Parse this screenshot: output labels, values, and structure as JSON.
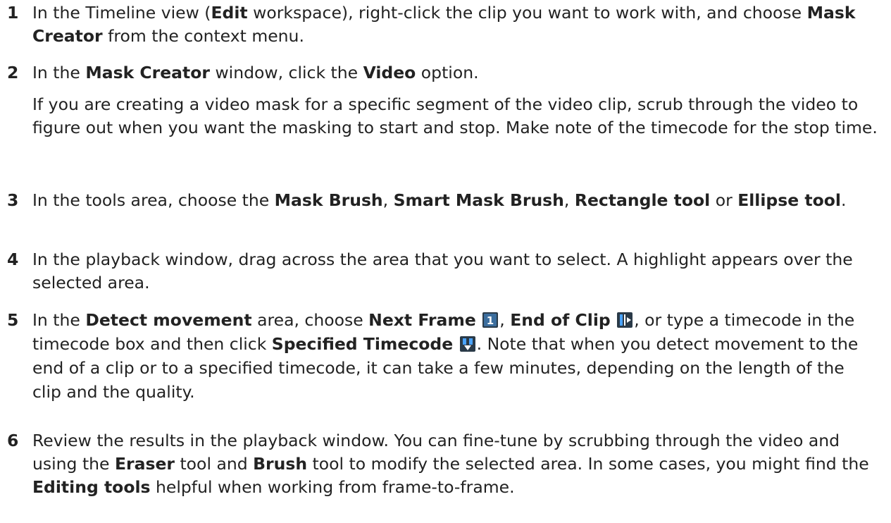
{
  "steps": [
    {
      "num": "1",
      "parts": [
        "In the Timeline view (",
        "Edit",
        " workspace), right-click the clip you want to work with, and choose ",
        "Mask Creator",
        " from the context menu."
      ]
    },
    {
      "num": "2",
      "parts": [
        "In the ",
        "Mask Creator",
        " window, click the ",
        "Video",
        " option."
      ],
      "note": "If you are creating a video mask for a specific segment of the video clip, scrub through the video to figure out when you want the masking to start and stop. Make note of the timecode for the stop time."
    },
    {
      "num": "3",
      "parts": [
        "In the tools area, choose the ",
        "Mask Brush",
        ", ",
        "Smart Mask Brush",
        ", ",
        "Rectangle tool",
        " or ",
        "Ellipse tool",
        "."
      ]
    },
    {
      "num": "4",
      "parts": [
        "In the playback window, drag across the area that you want to select. A highlight appears over the selected area."
      ]
    },
    {
      "num": "5",
      "parts": [
        "In the ",
        "Detect movement",
        " area, choose ",
        "Next Frame",
        ", ",
        "End of Clip",
        ", or type a timecode in the timecode box and then click ",
        "Specified Timecode",
        ". Note that when you detect movement to the end of a clip or to a specified timecode, it can take a few minutes, depending on the length of the clip and the quality."
      ],
      "icons": [
        "next-frame-icon",
        "end-of-clip-icon",
        "specified-timecode-icon"
      ]
    },
    {
      "num": "6",
      "parts": [
        "Review the results in the playback window. You can fine-tune by scrubbing through the video and using the ",
        "Eraser",
        " tool and ",
        "Brush",
        " tool to modify the selected area. In some cases, you might find the ",
        "Editing tools",
        " helpful when working from frame-to-frame."
      ]
    }
  ],
  "colors": {
    "text": "#222222",
    "icon_bg": "#2a3a48",
    "icon_accent": "#4aa3ff"
  }
}
